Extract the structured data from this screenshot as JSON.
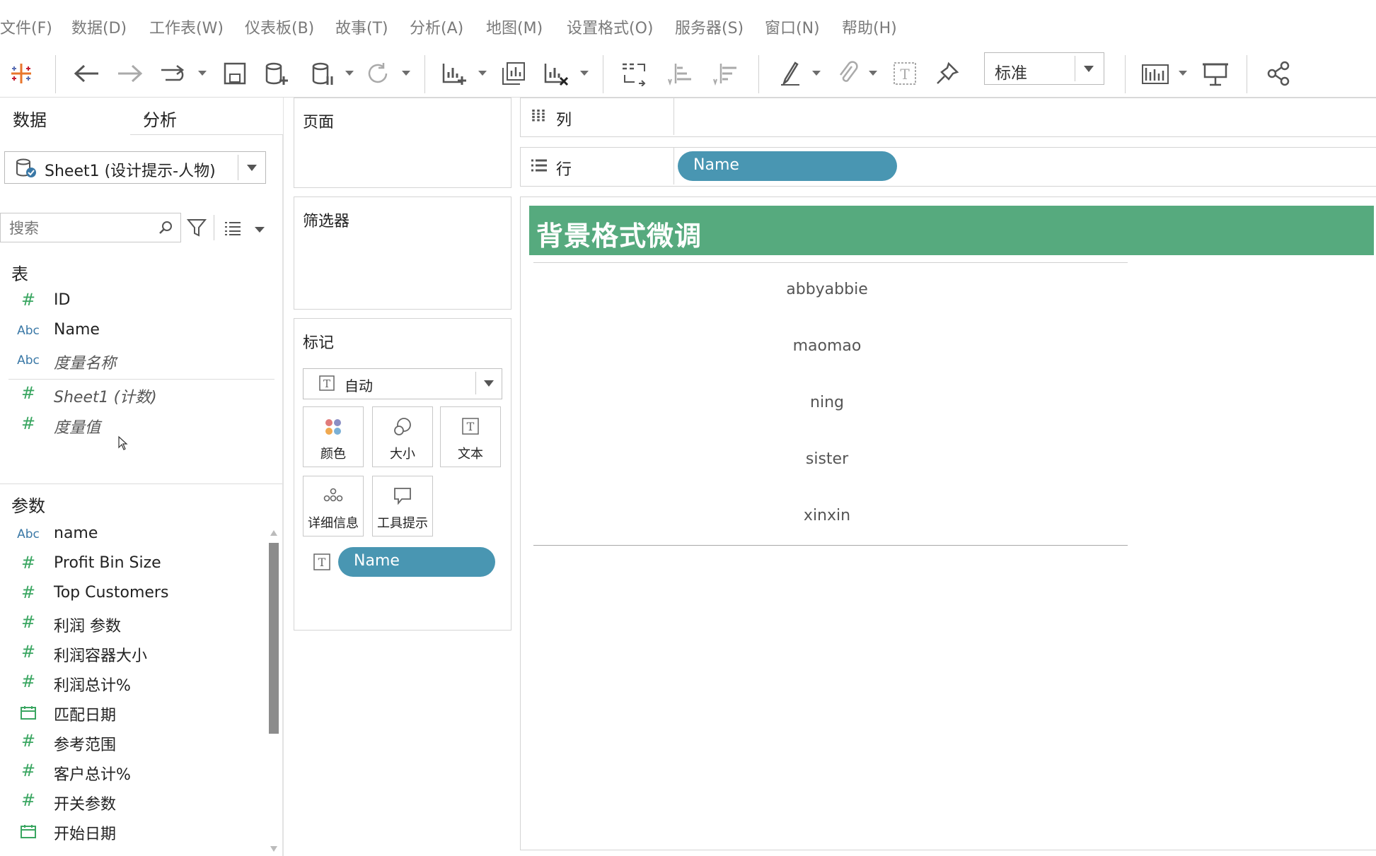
{
  "menu": [
    "文件(F)",
    "数据(D)",
    "工作表(W)",
    "仪表板(B)",
    "故事(T)",
    "分析(A)",
    "地图(M)",
    "设置格式(O)",
    "服务器(S)",
    "窗口(N)",
    "帮助(H)"
  ],
  "toolbar": {
    "fit_select": "标准"
  },
  "left_pane": {
    "tabs": {
      "data": "数据",
      "analysis": "分析"
    },
    "collapse_icon": "chevron-left-icon",
    "datasource": "Sheet1 (设计提示-人物)",
    "search_placeholder": "搜索",
    "tables_label": "表",
    "fields": [
      {
        "type": "#",
        "name": "ID"
      },
      {
        "type": "Abc",
        "name": "Name"
      },
      {
        "type": "Abc",
        "name": "度量名称"
      },
      {
        "type": "#",
        "name": "Sheet1 (计数)"
      },
      {
        "type": "#",
        "name": "度量值"
      }
    ],
    "params_label": "参数",
    "params": [
      {
        "type": "Abc",
        "name": "name"
      },
      {
        "type": "#",
        "name": "Profit Bin Size"
      },
      {
        "type": "#",
        "name": "Top Customers"
      },
      {
        "type": "#",
        "name": "利润 参数"
      },
      {
        "type": "#",
        "name": "利润容器大小"
      },
      {
        "type": "#",
        "name": "利润总计%"
      },
      {
        "type": "date",
        "name": "匹配日期"
      },
      {
        "type": "#",
        "name": "参考范围"
      },
      {
        "type": "#",
        "name": "客户总计%"
      },
      {
        "type": "#",
        "name": "开关参数"
      },
      {
        "type": "date",
        "name": "开始日期"
      }
    ]
  },
  "cards": {
    "pages": "页面",
    "filters": "筛选器",
    "marks": "标记",
    "marks_type": "自动",
    "mark_buttons": [
      "颜色",
      "大小",
      "文本",
      "详细信息",
      "工具提示"
    ],
    "marks_pill": "Name"
  },
  "shelves": {
    "columns_label": "列",
    "rows_label": "行",
    "rows_pill": "Name"
  },
  "view": {
    "title": "背景格式微调",
    "title_color": "#56aa7e",
    "names": [
      "abbyabbie",
      "maomao",
      "ning",
      "sister",
      "xinxin"
    ]
  },
  "colors": {
    "pill": "#4996b2"
  }
}
